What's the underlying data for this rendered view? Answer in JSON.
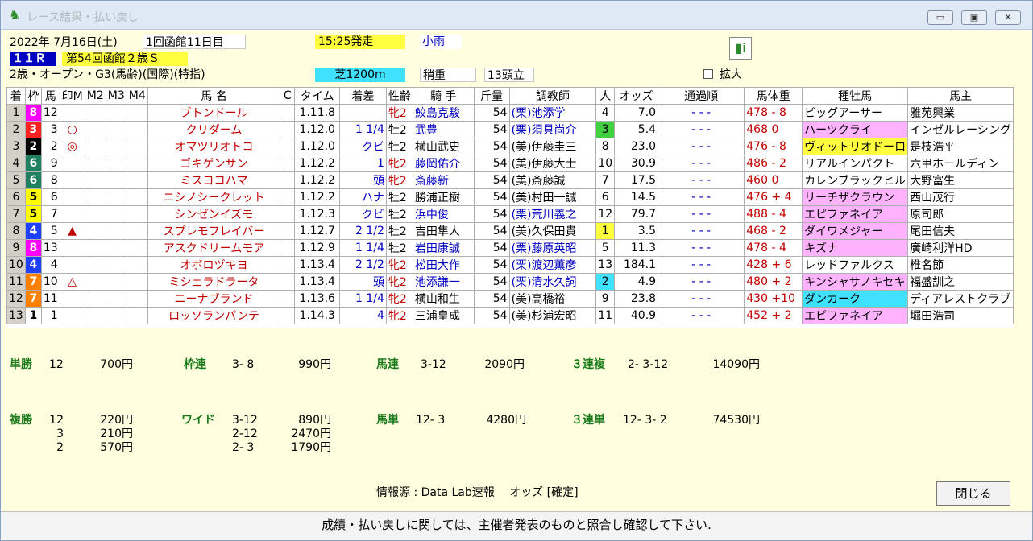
{
  "window": {
    "title": "レース結果・払い戻し"
  },
  "race": {
    "date": "2022年 7月16日(土)",
    "meeting": "1回函館11日目",
    "start": "15:25発走",
    "weather": "小雨",
    "rnum": "１１Ｒ",
    "name": "第54回函館２歳Ｓ",
    "condition": "2歳・オープン・G3(馬齢)(国際)(特指)",
    "course": "芝1200m",
    "track": "稍重",
    "heads": "13頭立",
    "zoom": "拡大"
  },
  "columns": [
    "着",
    "枠",
    "馬",
    "印M",
    "M2",
    "M3",
    "M4",
    "馬 名",
    "C",
    "タイム",
    "着差",
    "性齢",
    "騎 手",
    "斤量",
    "調教師",
    "人",
    "オッズ",
    "通過順",
    "馬体重",
    "種牡馬",
    "馬主"
  ],
  "rows": [
    {
      "rank": "1",
      "waku": "8",
      "wc": "#ff00ff",
      "wt": "#fff",
      "no": "12",
      "mark": "",
      "name": "ブトンドール",
      "time": "1.11.8",
      "diff": "",
      "sex": "牝2",
      "sexc": "red",
      "jockey": "鮫島克駿",
      "jc": "blue",
      "wt_": "54",
      "trainer": "(栗)池添学",
      "tc": "blue",
      "pop": "4",
      "popc": "",
      "odds": "7.0",
      "pass": "- - -",
      "bw": "478 - 8",
      "sire": "ビッグアーサー",
      "sc": "",
      "owner": "雅苑興業"
    },
    {
      "rank": "2",
      "waku": "3",
      "wc": "#ff2020",
      "wt": "#fff",
      "no": "3",
      "mark": "○",
      "name": "クリダーム",
      "time": "1.12.0",
      "diff": "1 1/4",
      "sex": "牡2",
      "sexc": "",
      "jockey": "武豊",
      "jc": "blue",
      "wt_": "54",
      "trainer": "(栗)須貝尚介",
      "tc": "blue",
      "pop": "3",
      "popc": "greenbg",
      "odds": "5.4",
      "pass": "- - -",
      "bw": "468   0",
      "sire": "ハーツクライ",
      "sc": "pink",
      "owner": "インゼルレーシング"
    },
    {
      "rank": "3",
      "waku": "2",
      "wc": "#000",
      "wt": "#fff",
      "no": "2",
      "mark": "◎",
      "name": "オマツリオトコ",
      "time": "1.12.0",
      "diff": "クビ",
      "sex": "牡2",
      "sexc": "",
      "jockey": "横山武史",
      "jc": "",
      "wt_": "54",
      "trainer": "(美)伊藤圭三",
      "tc": "",
      "pop": "8",
      "popc": "",
      "odds": "23.0",
      "pass": "- - -",
      "bw": "476 - 8",
      "sire": "ヴィットリオドーロ",
      "sc": "yellowbg",
      "owner": "是枝浩平"
    },
    {
      "rank": "4",
      "waku": "6",
      "wc": "#208060",
      "wt": "#fff",
      "no": "9",
      "mark": "",
      "name": "ゴキゲンサン",
      "time": "1.12.2",
      "diff": "1",
      "sex": "牝2",
      "sexc": "red",
      "jockey": "藤岡佑介",
      "jc": "blue",
      "wt_": "54",
      "trainer": "(美)伊藤大士",
      "tc": "",
      "pop": "10",
      "popc": "",
      "odds": "30.9",
      "pass": "- - -",
      "bw": "486 - 2",
      "sire": "リアルインパクト",
      "sc": "",
      "owner": "六甲ホールディン"
    },
    {
      "rank": "5",
      "waku": "6",
      "wc": "#208060",
      "wt": "#fff",
      "no": "8",
      "mark": "",
      "name": "ミスヨコハマ",
      "time": "1.12.2",
      "diff": "頭",
      "sex": "牝2",
      "sexc": "red",
      "jockey": "斎藤新",
      "jc": "blue",
      "wt_": "54",
      "trainer": "(美)斎藤誠",
      "tc": "",
      "pop": "7",
      "popc": "",
      "odds": "17.5",
      "pass": "- - -",
      "bw": "460   0",
      "sire": "カレンブラックヒル",
      "sc": "",
      "owner": "大野富生"
    },
    {
      "rank": "6",
      "waku": "5",
      "wc": "#ffff00",
      "wt": "#000",
      "no": "6",
      "mark": "",
      "name": "ニシノシークレット",
      "time": "1.12.2",
      "diff": "ハナ",
      "sex": "牡2",
      "sexc": "",
      "jockey": "勝浦正樹",
      "jc": "",
      "wt_": "54",
      "trainer": "(美)村田一誠",
      "tc": "",
      "pop": "6",
      "popc": "",
      "odds": "14.5",
      "pass": "- - -",
      "bw": "476 + 4",
      "sire": "リーチザクラウン",
      "sc": "pink",
      "owner": "西山茂行"
    },
    {
      "rank": "7",
      "waku": "5",
      "wc": "#ffff00",
      "wt": "#000",
      "no": "7",
      "mark": "",
      "name": "シンゼンイズモ",
      "time": "1.12.3",
      "diff": "クビ",
      "sex": "牡2",
      "sexc": "",
      "jockey": "浜中俊",
      "jc": "blue",
      "wt_": "54",
      "trainer": "(栗)荒川義之",
      "tc": "blue",
      "pop": "12",
      "popc": "",
      "odds": "79.7",
      "pass": "- - -",
      "bw": "488 - 4",
      "sire": "エピファネイア",
      "sc": "pink",
      "owner": "原司郎"
    },
    {
      "rank": "8",
      "waku": "4",
      "wc": "#2040ff",
      "wt": "#fff",
      "no": "5",
      "mark": "▲",
      "name": "スプレモフレイバー",
      "time": "1.12.7",
      "diff": "2 1/2",
      "sex": "牡2",
      "sexc": "",
      "jockey": "吉田隼人",
      "jc": "",
      "wt_": "54",
      "trainer": "(美)久保田貴",
      "tc": "",
      "pop": "1",
      "popc": "yellowbg",
      "odds": "3.5",
      "pass": "- - -",
      "bw": "468 - 2",
      "sire": "ダイワメジャー",
      "sc": "pink",
      "owner": "尾田信夫"
    },
    {
      "rank": "9",
      "waku": "8",
      "wc": "#ff00ff",
      "wt": "#fff",
      "no": "13",
      "mark": "",
      "name": "アスクドリームモア",
      "time": "1.12.9",
      "diff": "1 1/4",
      "sex": "牡2",
      "sexc": "",
      "jockey": "岩田康誠",
      "jc": "blue",
      "wt_": "54",
      "trainer": "(栗)藤原英昭",
      "tc": "blue",
      "pop": "5",
      "popc": "",
      "odds": "11.3",
      "pass": "- - -",
      "bw": "478 - 4",
      "sire": "キズナ",
      "sc": "pink",
      "owner": "廣崎利洋HD"
    },
    {
      "rank": "10",
      "waku": "4",
      "wc": "#2040ff",
      "wt": "#fff",
      "no": "4",
      "mark": "",
      "name": "オボロヅキヨ",
      "time": "1.13.4",
      "diff": "2 1/2",
      "sex": "牝2",
      "sexc": "red",
      "jockey": "松田大作",
      "jc": "blue",
      "wt_": "54",
      "trainer": "(栗)渡辺薫彦",
      "tc": "blue",
      "pop": "13",
      "popc": "",
      "odds": "184.1",
      "pass": "- - -",
      "bw": "428 + 6",
      "sire": "レッドファルクス",
      "sc": "",
      "owner": "椎名節"
    },
    {
      "rank": "11",
      "waku": "7",
      "wc": "#ff8000",
      "wt": "#fff",
      "no": "10",
      "mark": "△",
      "name": "ミシェラドラータ",
      "time": "1.13.4",
      "diff": "頭",
      "sex": "牝2",
      "sexc": "red",
      "jockey": "池添謙一",
      "jc": "blue",
      "wt_": "54",
      "trainer": "(栗)清水久詞",
      "tc": "blue",
      "pop": "2",
      "popc": "cyanbg",
      "odds": "4.9",
      "pass": "- - -",
      "bw": "480 + 2",
      "sire": "キンシャサノキセキ",
      "sc": "pink",
      "owner": "福盛訓之"
    },
    {
      "rank": "12",
      "waku": "7",
      "wc": "#ff8000",
      "wt": "#fff",
      "no": "11",
      "mark": "",
      "name": "ニーナブランド",
      "time": "1.13.6",
      "diff": "1 1/4",
      "sex": "牝2",
      "sexc": "red",
      "jockey": "横山和生",
      "jc": "",
      "wt_": "54",
      "trainer": "(美)高橋裕",
      "tc": "",
      "pop": "9",
      "popc": "",
      "odds": "23.8",
      "pass": "- - -",
      "bw": "430 +10",
      "sire": "ダンカーク",
      "sc": "cyanbg",
      "owner": "ディアレストクラブ"
    },
    {
      "rank": "13",
      "waku": "1",
      "wc": "#fff",
      "wt": "#000",
      "no": "1",
      "mark": "",
      "name": "ロッソランパンテ",
      "time": "1.14.3",
      "diff": "4",
      "sex": "牝2",
      "sexc": "red",
      "jockey": "三浦皇成",
      "jc": "",
      "wt_": "54",
      "trainer": "(美)杉浦宏昭",
      "tc": "",
      "pop": "11",
      "popc": "",
      "odds": "40.9",
      "pass": "- - -",
      "bw": "452 + 2",
      "sire": "エピファネイア",
      "sc": "pink",
      "owner": "堀田浩司"
    }
  ],
  "payout": {
    "tansho": {
      "label": "単勝",
      "n": "12",
      "y": "700円"
    },
    "wakuren": {
      "label": "枠連",
      "n": "3- 8",
      "y": "990円"
    },
    "umaren": {
      "label": "馬連",
      "n": "3-12",
      "y": "2090円"
    },
    "sanfuku": {
      "label": "３連複",
      "n": "2- 3-12",
      "y": "14090円"
    },
    "fukusho": {
      "label": "複勝",
      "n": [
        "12",
        "3",
        "2"
      ],
      "y": [
        "220円",
        "210円",
        "570円"
      ]
    },
    "wide": {
      "label": "ワイド",
      "n": [
        "3-12",
        "2-12",
        "2- 3"
      ],
      "y": [
        "890円",
        "2470円",
        "1790円"
      ]
    },
    "umatan": {
      "label": "馬単",
      "n": "12- 3",
      "y": "4280円"
    },
    "santan": {
      "label": "３連単",
      "n": "12- 3- 2",
      "y": "74530円"
    }
  },
  "info": "情報源 : Data Lab速報　 オッズ [確定]",
  "close_label": "閉じる",
  "footer": "成績・払い戻しに関しては、主催者発表のものと照合し確認して下さい."
}
